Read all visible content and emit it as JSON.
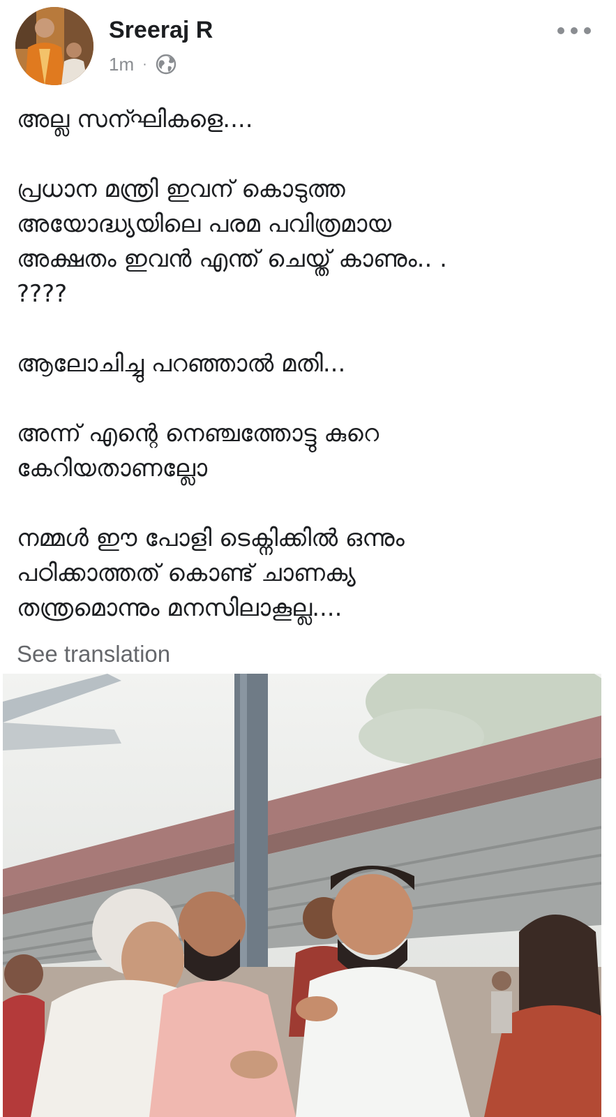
{
  "post": {
    "author": "Sreeraj R",
    "timestamp": "1m",
    "separator": "·",
    "privacy_icon": "globe-icon",
    "more_icon": "more-options-icon",
    "paragraphs": [
      "അല്ല സന്ഘികളെ....",
      "പ്രധാന മന്ത്രി ഇവന് കൊടുത്ത\nഅയോദ്ധ്യയിലെ  പരമ പവിത്രമായ\nഅക്ഷതം ഇവൻ എന്ത് ചെയ്ത് കാണും..  .\n????",
      "ആലോചിച്ചു പറഞ്ഞാൽ മതി...",
      "അന്ന് എന്റെ നെഞ്ചത്തോട്ടു കുറെ\nകേറിയതാണല്ലോ",
      "നമ്മൾ ഈ പോളി ടെക്നിക്കിൽ ഒന്നും\nപഠിക്കാത്തത് കൊണ്ട് ചാണക്യ\nതന്ത്രമൊന്നും മനസിലാകൂല്ല...."
    ],
    "see_translation": "See translation"
  },
  "colors": {
    "name": "#1c1e21",
    "meta": "#8a8d91",
    "link": "#65676b"
  }
}
